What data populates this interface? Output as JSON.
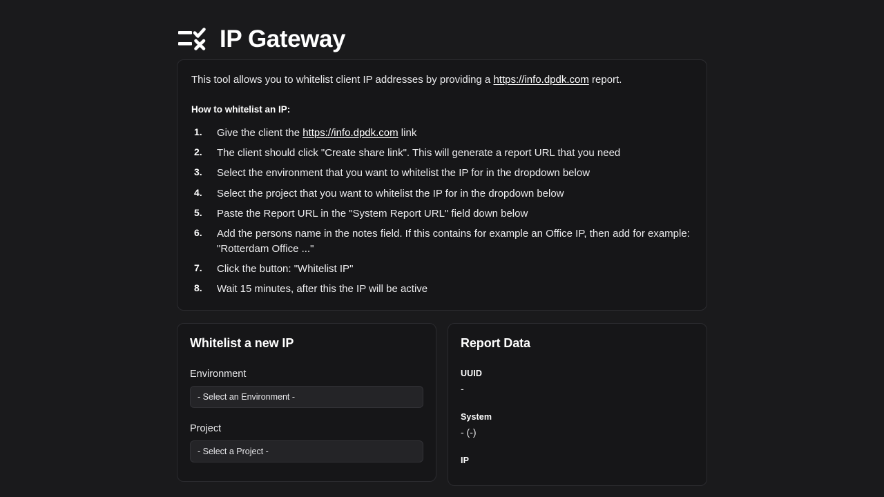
{
  "header": {
    "title": "IP Gateway",
    "icon": "list-check-cross-icon"
  },
  "info": {
    "intro_before": "This tool allows you to whitelist client IP addresses by providing a ",
    "intro_link": "https://info.dpdk.com",
    "intro_after": " report.",
    "howto_heading": "How to whitelist an IP:",
    "steps": [
      {
        "num": "1.",
        "before": "Give the client the ",
        "link": "https://info.dpdk.com",
        "after": " link"
      },
      {
        "num": "2.",
        "before": "The client should click \"Create share link\". This will generate a report URL that you need",
        "link": "",
        "after": ""
      },
      {
        "num": "3.",
        "before": "Select the environment that you want to whitelist the IP for in the dropdown below",
        "link": "",
        "after": ""
      },
      {
        "num": "4.",
        "before": "Select the project that you want to whitelist the IP for in the dropdown below",
        "link": "",
        "after": ""
      },
      {
        "num": "5.",
        "before": "Paste the Report URL in the \"System Report URL\" field down below",
        "link": "",
        "after": ""
      },
      {
        "num": "6.",
        "before": "Add the persons name in the notes field. If this contains for example an Office IP, then add for example: \"Rotterdam Office ...\"",
        "link": "",
        "after": ""
      },
      {
        "num": "7.",
        "before": "Click the button: \"Whitelist IP\"",
        "link": "",
        "after": ""
      },
      {
        "num": "8.",
        "before": "Wait 15 minutes, after this the IP will be active",
        "link": "",
        "after": ""
      }
    ]
  },
  "form": {
    "title": "Whitelist a new IP",
    "environment_label": "Environment",
    "environment_value": "- Select an Environment -",
    "project_label": "Project",
    "project_value": "- Select a Project -"
  },
  "report": {
    "title": "Report Data",
    "uuid_label": "UUID",
    "uuid_value": "-",
    "system_label": "System",
    "system_value": "- (-)",
    "ip_label": "IP"
  },
  "colors": {
    "page_background": "#1a1a1c",
    "card_background": "#161618",
    "card_border": "#2b2b2f",
    "input_background": "#242427",
    "text": "#ededef",
    "heading": "#ffffff"
  }
}
